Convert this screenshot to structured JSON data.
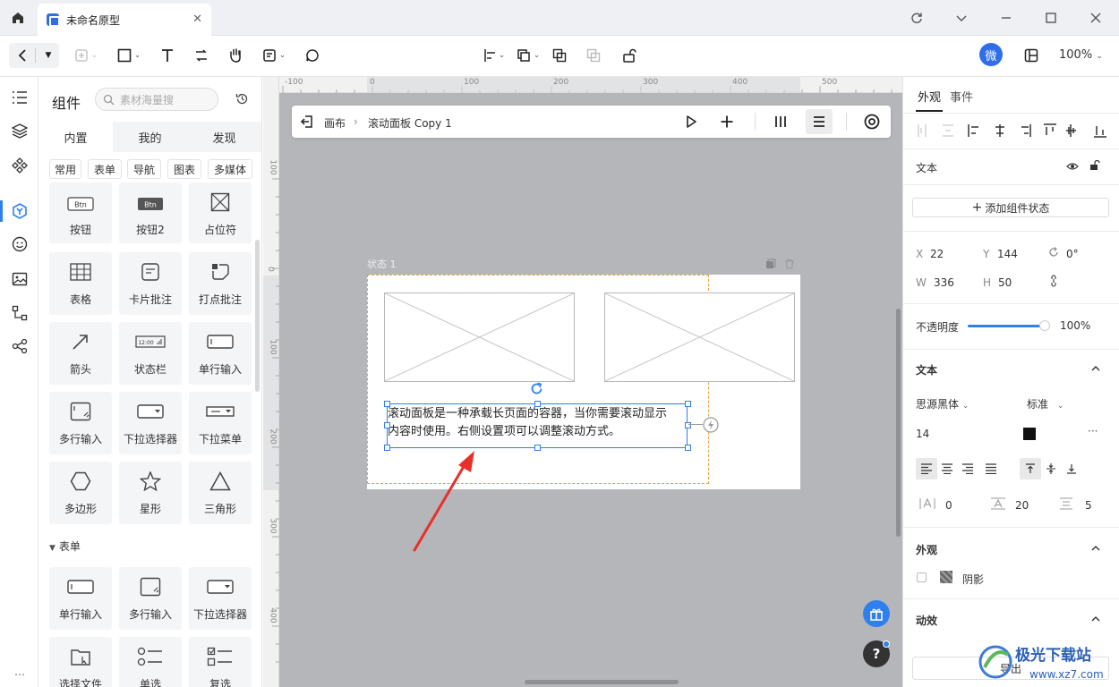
{
  "window": {
    "tab_title": "未命名原型"
  },
  "toolbar": {
    "avatar": "微",
    "zoom": "100%"
  },
  "components": {
    "title": "组件",
    "search_placeholder": "素材海量搜",
    "tabs": [
      "内置",
      "我的",
      "发现"
    ],
    "chips": [
      "常用",
      "表单",
      "导航",
      "图表",
      "多媒体"
    ],
    "cards": [
      "按钮",
      "按钮2",
      "占位符",
      "表格",
      "卡片批注",
      "打点批注",
      "箭头",
      "状态栏",
      "单行输入",
      "多行输入",
      "下拉选择器",
      "下拉菜单",
      "多边形",
      "星形",
      "三角形"
    ],
    "section": "表单",
    "form_cards": [
      "单行输入",
      "多行输入",
      "下拉选择器",
      "选择文件",
      "单选",
      "复选"
    ],
    "btn_text": "Btn",
    "statusbar_time": "12:00"
  },
  "ruler": {
    "h": [
      "-100",
      "0",
      "100",
      "200",
      "300",
      "400",
      "500"
    ],
    "v": [
      "100",
      "0",
      "100",
      "200",
      "300",
      "400"
    ]
  },
  "canvas": {
    "crumb_root": "画布",
    "crumb_current": "滚动面板 Copy 1",
    "state_label": "状态 1",
    "text_line1": "滚动面板是一种承载长页面的容器，当你需要滚动显示",
    "text_line2": "内容时使用。右侧设置项可以调整滚动方式。"
  },
  "inspector": {
    "tabs": [
      "外观",
      "事件"
    ],
    "type_label": "文本",
    "add_state": "添加组件状态",
    "x_label": "X",
    "x": "22",
    "y_label": "Y",
    "y": "144",
    "rotation": "0°",
    "w_label": "W",
    "w": "336",
    "h_label": "H",
    "h": "50",
    "opacity_label": "不透明度",
    "opacity": "100%",
    "opacity_fraction": 1.0,
    "text_section": "文本",
    "font": "思源黑体",
    "weight": "标准",
    "font_size": "14",
    "text_color": "#111111",
    "letter_spacing": "0",
    "line_height": "20",
    "paragraph": "5",
    "appearance_section": "外观",
    "shadow": "阴影",
    "effects_section": "动效",
    "export": "导出"
  },
  "watermark": {
    "title": "极光下载站",
    "url": "www.xz7.com"
  }
}
